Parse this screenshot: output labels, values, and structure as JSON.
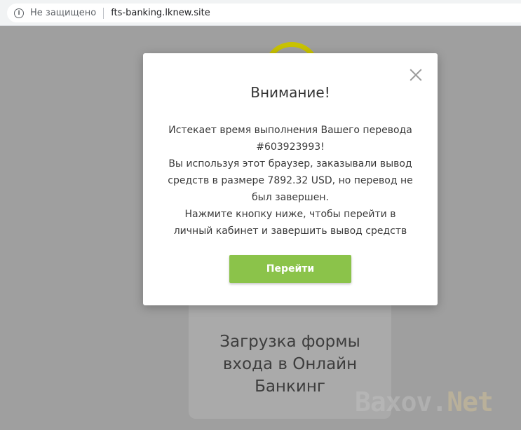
{
  "browser": {
    "security_text": "Не защищено",
    "url": "fts-banking.lknew.site",
    "info_icon": "info-icon"
  },
  "background": {
    "card_lines": [
      "Загрузка формы",
      "входа в Онлайн",
      "Банкинг"
    ],
    "logo_color": "#c8c200"
  },
  "modal": {
    "title": "Внимание!",
    "body_lines": [
      "Истекает время выполнения Вашего перевода",
      "#603923993!",
      "Вы используя этот браузер, заказывали вывод",
      "средств в размере 7892.32 USD, но перевод не",
      "был завершен.",
      "Нажмите кнопку ниже, чтобы перейти в",
      "личный кабинет и завершить вывод средств"
    ],
    "button_label": "Перейти",
    "button_color": "#8bc34a",
    "close_icon": "close-icon"
  },
  "watermark": {
    "part1": "Baxov.",
    "part2": "Net"
  }
}
